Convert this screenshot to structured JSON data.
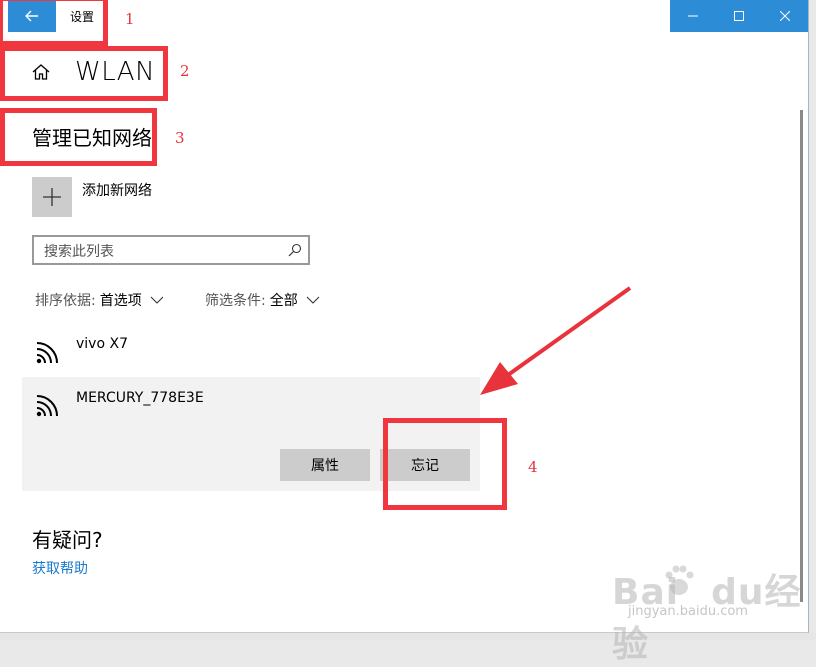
{
  "window": {
    "title": "设置",
    "controls": {
      "minimize": "minimize-icon",
      "maximize": "maximize-icon",
      "close": "close-icon"
    }
  },
  "header": {
    "page_title": "WLAN",
    "home_icon": "home-icon"
  },
  "section": {
    "title": "管理已知网络"
  },
  "add_network": {
    "label": "添加新网络"
  },
  "search": {
    "placeholder": "搜索此列表"
  },
  "filters": {
    "sort": {
      "label": "排序依据:",
      "value": "首选项"
    },
    "type": {
      "label": "筛选条件:",
      "value": "全部"
    }
  },
  "networks": [
    {
      "name": "vivo X7",
      "selected": false
    },
    {
      "name": "MERCURY_778E3E",
      "selected": true
    }
  ],
  "actions": {
    "properties": "属性",
    "forget": "忘记"
  },
  "help": {
    "title": "有疑问?",
    "link": "获取帮助"
  },
  "annotations": {
    "labels": [
      "1",
      "2",
      "3",
      "4"
    ],
    "color": "#f0373f"
  },
  "watermark": {
    "text": "Bai",
    "text2": "du",
    "brand": "经验",
    "url": "jingyan.baidu.com"
  },
  "colors": {
    "accent": "#2d8cd6",
    "link": "#1979ca",
    "selected_bg": "#f2f2f2",
    "button_bg": "#cccccc"
  }
}
